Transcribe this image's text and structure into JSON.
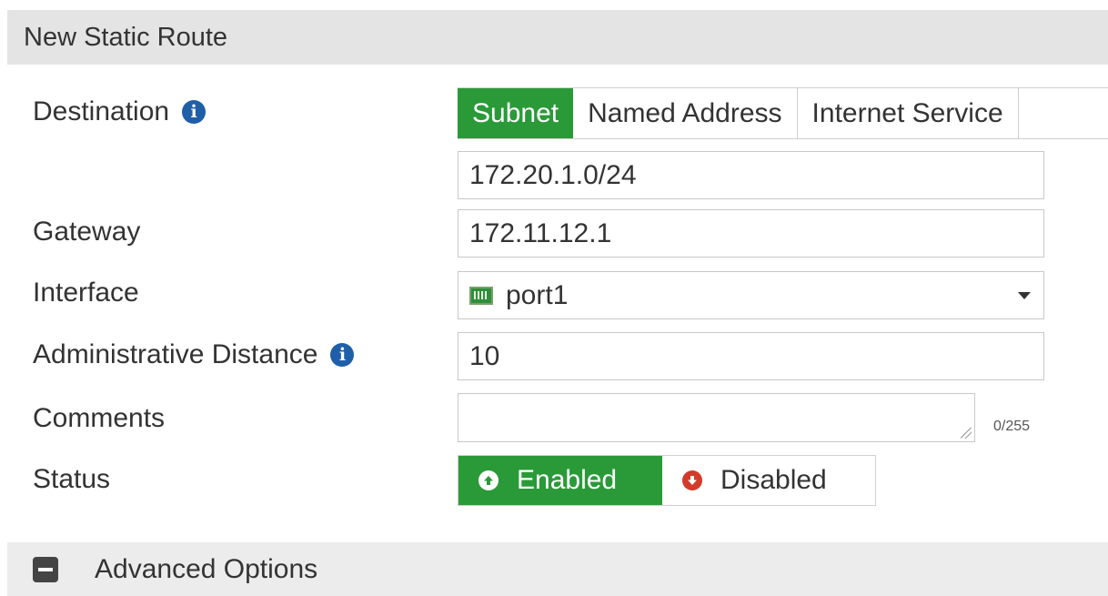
{
  "header": {
    "title": "New  Static Route"
  },
  "destination": {
    "label": "Destination",
    "tabs": [
      {
        "label": "Subnet",
        "active": true
      },
      {
        "label": "Named Address",
        "active": false
      },
      {
        "label": "Internet Service",
        "active": false
      }
    ],
    "subnet_value": "172.20.1.0/24"
  },
  "gateway": {
    "label": "Gateway",
    "value": "172.11.12.1"
  },
  "interface": {
    "label": "Interface",
    "value": "port1",
    "icon": "port-icon"
  },
  "admin_distance": {
    "label": "Administrative Distance",
    "value": "10"
  },
  "comments": {
    "label": "Comments",
    "value": "",
    "counter": "0/255"
  },
  "status": {
    "label": "Status",
    "enabled_label": "Enabled",
    "disabled_label": "Disabled",
    "selected": "Enabled"
  },
  "advanced": {
    "label": "Advanced Options"
  },
  "colors": {
    "accent": "#2a9a38",
    "info": "#1f5fa8",
    "danger": "#d23a2a"
  }
}
